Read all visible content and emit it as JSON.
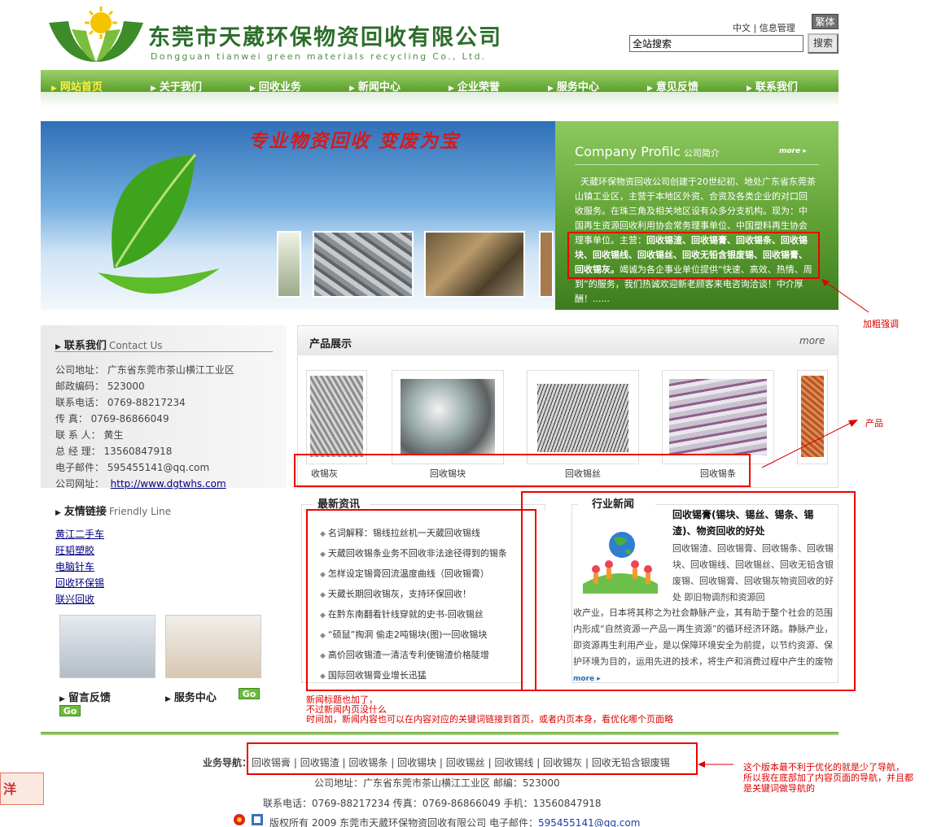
{
  "header": {
    "company_cn": "东莞市天葳环保物资回收有限公司",
    "company_en": "Dongguan tianwei green materials recycling Co., Ltd.",
    "lang_cn": "中文",
    "info_manage": "信息管理",
    "btn_traditional": "繁体",
    "search_value": "全站搜索",
    "search_button": "搜索"
  },
  "nav": [
    "网站首页",
    "关于我们",
    "回收业务",
    "新闻中心",
    "企业荣誉",
    "服务中心",
    "意见反馈",
    "联系我们"
  ],
  "banner": {
    "slogan": "专业物资回收  变废为宝"
  },
  "profile": {
    "title_en": "Company Profilc",
    "title_cn": "公司简介",
    "more": "more",
    "text_part1": "天葳环保物资回收公司创建于20世纪初、地处广东省东莞茶山镇工业区，主营于本地区外资、合资及各类企业的对口回收服务。在珠三角及相关地区设有众多分支机构。现为：中国再生资源回收利用协会常务理事单位、中国塑料再生协会理事单位。主营：",
    "text_bold": "回收锡渣、回收锡膏、回收锡条、回收锡块、回收锡线、回收锡丝、回收无铅含银废锡、回收锡膏、回收锡灰。",
    "text_part2": "竭诚为各企事业单位提供“快速、高效、热情、周到”的服务，我们热诚欢迎新老顾客来电咨询洽谈！中介厚酬！......"
  },
  "annotations": {
    "bold_note": "加粗强调",
    "product_note": "产品",
    "news_note_1": "新闻标题也加了，",
    "news_note_2": "不过新闻内页没什么",
    "news_note_3": "时间加，新闻内容也可以在内容对应的关键词链接到首页，或者内页本身，看优化哪个页面略",
    "footer_note_1": "这个版本最不利于优化的就是少了导航，",
    "footer_note_2": "所以我在底部加了内容页面的导航，并且都",
    "footer_note_3": "是关键词做导航的"
  },
  "contact": {
    "title": "联系我们",
    "title_en": "Contact Us",
    "rows": [
      "公司地址：  广东省东莞市茶山横江工业区",
      "邮政编码：  523000",
      "联系电话：  0769-88217234",
      "传    真：  0769-86866049",
      "联 系 人：  黄生",
      "总 经 理：  13560847918",
      "电子邮件：  595455141@qq.com"
    ],
    "website_label": "公司网址：",
    "website": "http://www.dgtwhs.com"
  },
  "friend": {
    "title": "友情链接",
    "title_en": "Friendly Line",
    "links": [
      "黄江二手车",
      "旺韬塑胶",
      "电脑针车",
      "回收环保锡",
      "联兴回收"
    ]
  },
  "bottom_left": {
    "feedback": "留言反馈",
    "service": "服务中心",
    "go": "Go"
  },
  "products": {
    "title": "产品展示",
    "more": "more",
    "items": [
      "收锡灰",
      "回收锡块",
      "回收锡丝",
      "回收锡条"
    ]
  },
  "news": {
    "title": "最新资讯",
    "items": [
      "名词解释：锡线拉丝机一天葳回收锡线",
      "天葳回收锡条业务不回收非法途径得到的锡条",
      "怎样设定锡膏回流温度曲线（回收锡膏）",
      "天葳长期回收锡灰，支持环保回收！",
      "在黔东南翻看针线穿就的史书-回收锡丝",
      "“硕鼠”掏洞  偷走2吨锡块(图)一回收锡块",
      "高价回收锡渣一清洁专利使锡渣价格陡增",
      "国际回收锡膏业增长迅猛"
    ]
  },
  "industry": {
    "title": "行业新闻",
    "headline": "回收锡膏(锡块、锡丝、锡条、锡渣)、物资回收的好处",
    "body1": "回收锡渣、回收锡膏、回收锡条、回收锡块、回收锡线、回收锡丝、回收无铅含银废锡、回收锡膏、回收锡灰物资回收的好处  即旧物调剂和资源回",
    "body2": "收产业，日本将其称之为社会静脉产业，其有助于整个社会的范围内形成“自然资源一产品一再生资源”的循环经济环路。静脉产业，即资源再生利用产业，是以保障环境安全为前提，以节约资源、保护环境为目的，运用先进的技术，将生产和消费过程中产生的废物",
    "more": "more"
  },
  "footer": {
    "nav_label": "业务导航：",
    "nav": [
      "回收锡膏",
      "回收锡渣",
      "回收锡条",
      "回收锡块",
      "回收锡丝",
      "回收锡线",
      "回收锡灰",
      "回收无铅含银废锡"
    ],
    "address": "公司地址：广东省东莞市茶山横江工业区    邮编：523000",
    "phones": "联系电话：0769-88217234 传真：0769-86866049 手机：13560847918",
    "copyright": "版权所有  2009 东莞市天葳环保物资回收有限公司  电子邮件：",
    "email": "595455141@qq.com",
    "seal_text": "洋"
  },
  "colors": {
    "brand_green": "#5da22f",
    "nav_active": "#ffee44",
    "annotation_red": "#dd0000"
  }
}
